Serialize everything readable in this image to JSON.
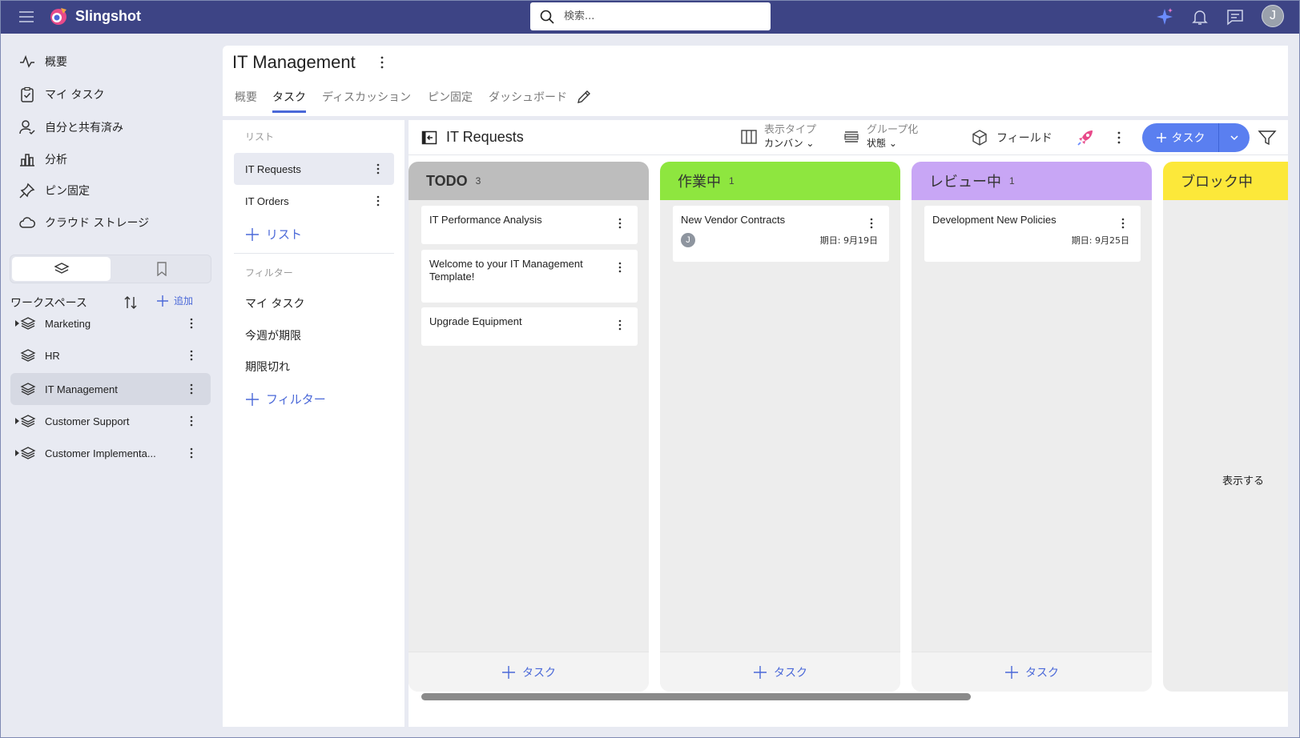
{
  "app": {
    "name": "Slingshot",
    "search_placeholder": "検索...",
    "user_initial": "J"
  },
  "sidebar": {
    "nav": [
      {
        "label": "概要",
        "icon": "activity-icon"
      },
      {
        "label": "マイ タスク",
        "icon": "clipboard-check-icon"
      },
      {
        "label": "自分と共有済み",
        "icon": "user-shared-icon"
      },
      {
        "label": "分析",
        "icon": "bar-chart-icon"
      },
      {
        "label": "ピン固定",
        "icon": "pin-icon"
      },
      {
        "label": "クラウド ストレージ",
        "icon": "cloud-icon"
      }
    ],
    "workspace_title": "ワークスペース",
    "add_label": "追加",
    "workspaces": [
      {
        "label": "Marketing",
        "expandable": true
      },
      {
        "label": "HR",
        "expandable": false
      },
      {
        "label": "IT Management",
        "expandable": false,
        "active": true
      },
      {
        "label": "Customer Support",
        "expandable": true
      },
      {
        "label": "Customer Implementa...",
        "expandable": true
      }
    ]
  },
  "header": {
    "title": "IT Management",
    "tabs": [
      "概要",
      "タスク",
      "ディスカッション",
      "ピン固定",
      "ダッシュボード"
    ],
    "active_tab": "タスク"
  },
  "lists_panel": {
    "lists_heading": "リスト",
    "lists": [
      "IT Requests",
      "IT Orders"
    ],
    "add_list": "リスト",
    "filters_heading": "フィルター",
    "filters": [
      "マイ タスク",
      "今週が期限",
      "期限切れ"
    ],
    "add_filter": "フィルター"
  },
  "board": {
    "title": "IT Requests",
    "view_type_label": "表示タイプ",
    "view_type_value": "カンバン",
    "group_label": "グループ化",
    "group_value": "状態",
    "fields_label": "フィールド",
    "add_task_label": "タスク",
    "column_add_label": "タスク",
    "empty_text": "表示する",
    "columns": [
      {
        "name": "TODO",
        "count": "3",
        "color": "#bdbdbd",
        "cards": [
          {
            "title": "IT Performance Analysis"
          },
          {
            "title": "Welcome to your IT Management Template!"
          },
          {
            "title": "Upgrade Equipment"
          }
        ]
      },
      {
        "name": "作業中",
        "count": "1",
        "color": "#8ee63f",
        "cards": [
          {
            "title": "New Vendor Contracts",
            "assignee": "J",
            "due": "期日: 9月19日"
          }
        ]
      },
      {
        "name": "レビュー中",
        "count": "1",
        "color": "#c8a6f5",
        "cards": [
          {
            "title": "Development New Policies",
            "due": "期日: 9月25日"
          }
        ]
      },
      {
        "name": "ブロック中",
        "count": "",
        "color": "#fce83a",
        "cards": []
      }
    ]
  },
  "colors": {
    "topbar": "#3d4485",
    "accent": "#5a7ff0",
    "link": "#4a68d8"
  }
}
